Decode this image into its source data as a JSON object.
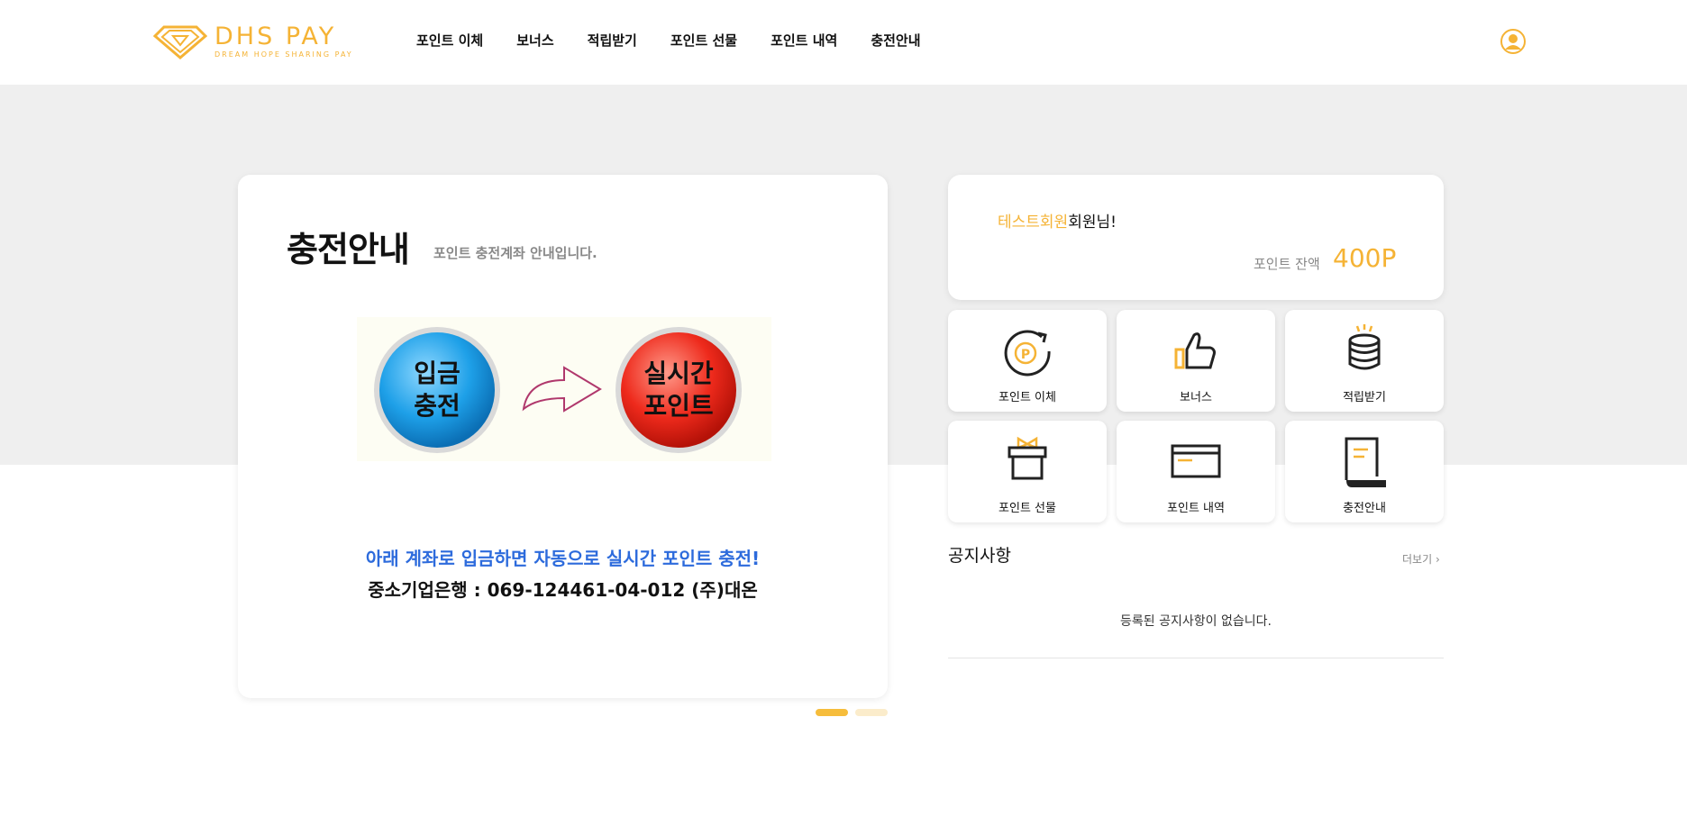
{
  "brand": {
    "name": "DHS PAY",
    "tagline": "DREAM HOPE SHARING PAY",
    "color": "#f5b335"
  },
  "nav": [
    {
      "label": "포인트 이체"
    },
    {
      "label": "보너스"
    },
    {
      "label": "적립받기"
    },
    {
      "label": "포인트 선물"
    },
    {
      "label": "포인트 내역"
    },
    {
      "label": "충전안내"
    }
  ],
  "header": {
    "user_icon": "user-circle-icon"
  },
  "main": {
    "title": "충전안내",
    "subtitle": "포인트 충전계좌 안내입니다.",
    "banner": {
      "left_button": "입금\n충전",
      "right_button": "실시간\n포인트"
    },
    "line1": "아래 계좌로 입금하면 자동으로 실시간 포인트 충전!",
    "line2": "중소기업은행 : 069-124461-04-012 (주)대온",
    "slides_total": 2,
    "active_slide": 1
  },
  "member": {
    "name": "테스트회원",
    "suffix": "회원님!",
    "balance_label": "포인트 잔액",
    "balance": "400P"
  },
  "tiles": [
    {
      "label": "포인트 이체",
      "icon": "point-transfer-icon"
    },
    {
      "label": "보너스",
      "icon": "thumbs-up-icon"
    },
    {
      "label": "적립받기",
      "icon": "coin-stack-icon"
    },
    {
      "label": "포인트 선물",
      "icon": "gift-box-icon"
    },
    {
      "label": "포인트 내역",
      "icon": "card-icon"
    },
    {
      "label": "충전안내",
      "icon": "document-icon"
    }
  ],
  "notice": {
    "title": "공지사항",
    "more": "더보기",
    "empty": "등록된 공지사항이 없습니다."
  }
}
